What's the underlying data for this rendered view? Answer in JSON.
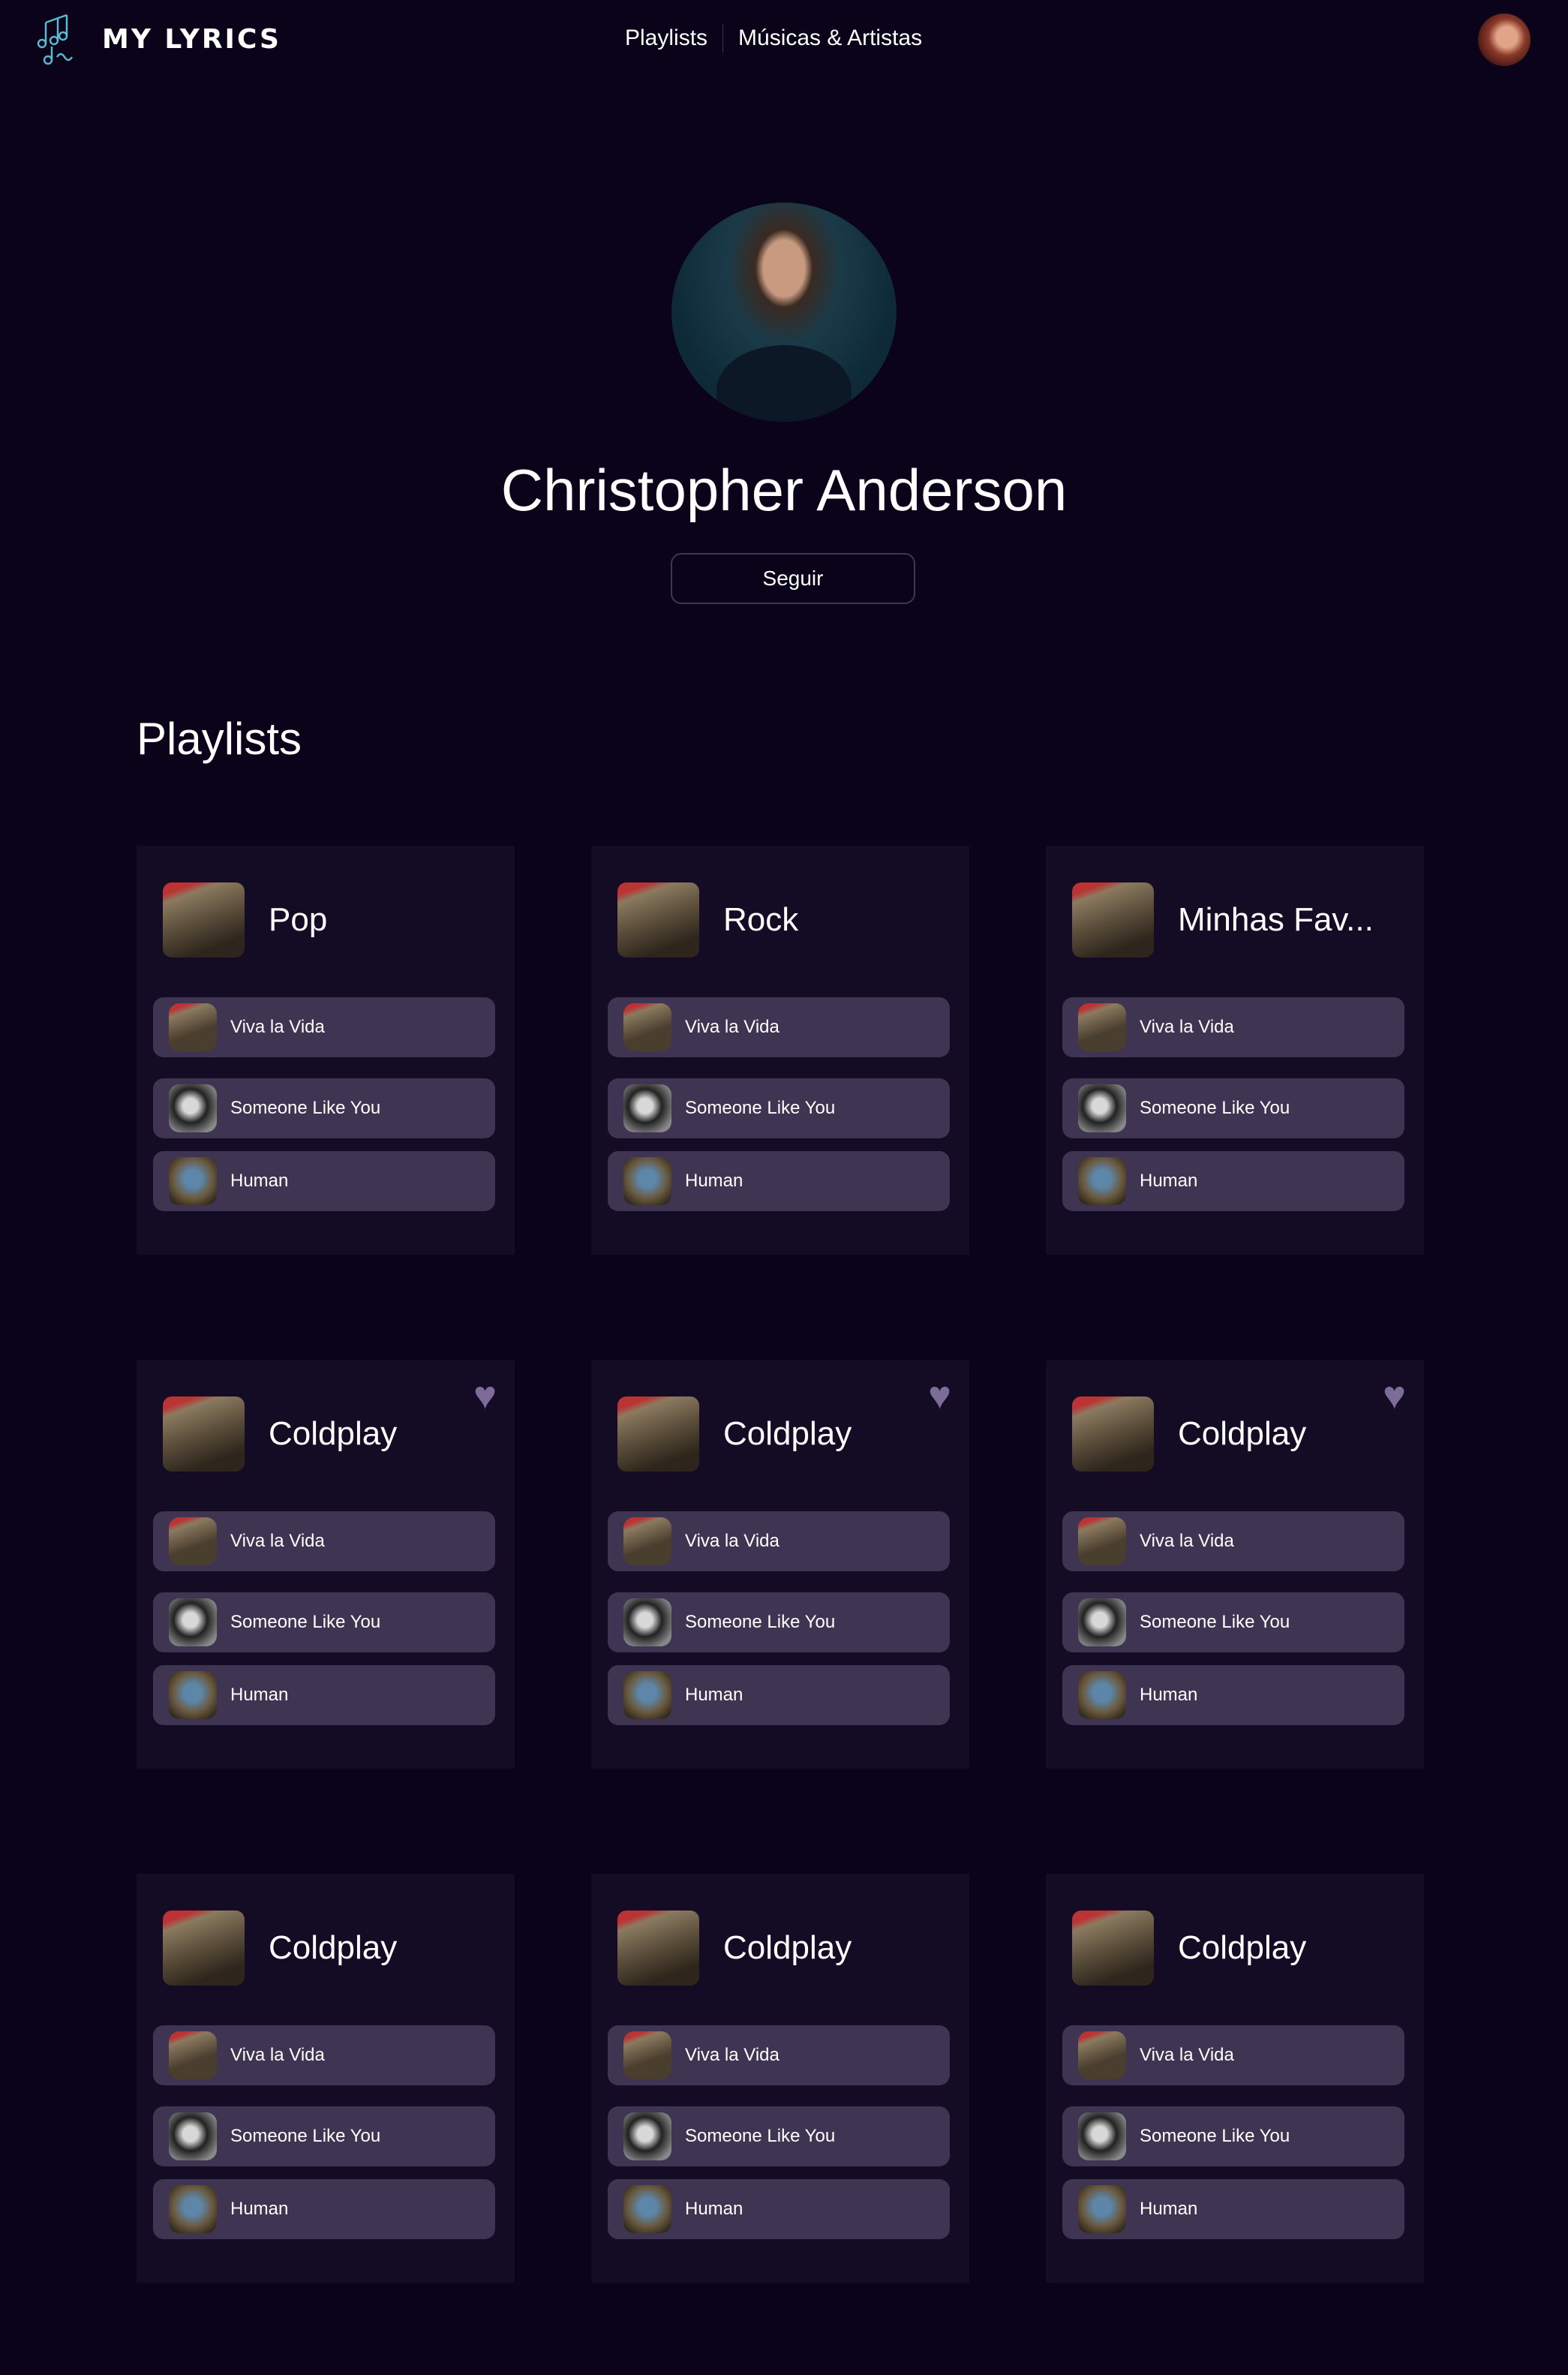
{
  "header": {
    "logo_text": "MY LYRICS",
    "logo_icon": "music-notes-icon",
    "nav": [
      "Playlists",
      "Músicas & Artistas"
    ],
    "user_avatar": "user-avatar"
  },
  "profile": {
    "name": "Christopher Anderson",
    "follow_label": "Seguir"
  },
  "section_title": "Playlists",
  "colors": {
    "background": "#0a0319",
    "card": "#130c24",
    "song_row": "#3f3552",
    "heart": "#7d6c98"
  },
  "playlists": [
    {
      "title": "Pop",
      "cover_text": "VIVA LA VIDA",
      "favorite": false,
      "songs": [
        "Viva la Vida",
        "Someone Like You",
        "Human"
      ]
    },
    {
      "title": "Rock",
      "cover_text": "VIVA LA VIDA",
      "favorite": false,
      "songs": [
        "Viva la Vida",
        "Someone Like You",
        "Human"
      ]
    },
    {
      "title": "Minhas Fav...",
      "cover_text": "VIVA LA VIDA",
      "favorite": false,
      "songs": [
        "Viva la Vida",
        "Someone Like You",
        "Human"
      ]
    },
    {
      "title": "Coldplay",
      "cover_text": "VIVA LA VIDA",
      "favorite": true,
      "songs": [
        "Viva la Vida",
        "Someone Like You",
        "Human"
      ]
    },
    {
      "title": "Coldplay",
      "cover_text": "VIVA LA VIDA",
      "favorite": true,
      "songs": [
        "Viva la Vida",
        "Someone Like You",
        "Human"
      ]
    },
    {
      "title": "Coldplay",
      "cover_text": "VIVA LA VIDA",
      "favorite": true,
      "songs": [
        "Viva la Vida",
        "Someone Like You",
        "Human"
      ]
    },
    {
      "title": "Coldplay",
      "cover_text": "VIVA LA VIDA",
      "favorite": false,
      "songs": [
        "Viva la Vida",
        "Someone Like You",
        "Human"
      ]
    },
    {
      "title": "Coldplay",
      "cover_text": "VIVA LA VIDA",
      "favorite": false,
      "songs": [
        "Viva la Vida",
        "Someone Like You",
        "Human"
      ]
    },
    {
      "title": "Coldplay",
      "cover_text": "VIVA LA VIDA",
      "favorite": false,
      "songs": [
        "Viva la Vida",
        "Someone Like You",
        "Human"
      ]
    }
  ]
}
